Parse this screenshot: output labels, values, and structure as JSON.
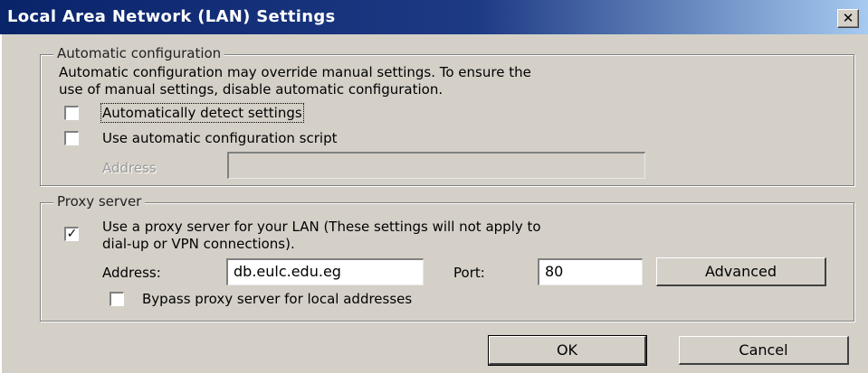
{
  "dialog": {
    "title": "Local Area Network (LAN) Settings",
    "close_glyph": "✕"
  },
  "auto_config": {
    "group_label": "Automatic configuration",
    "description_line1": "Automatic configuration may override manual settings.  To ensure the",
    "description_line2": "use of manual settings, disable automatic configuration.",
    "detect_label": "Automatically detect settings",
    "detect_checked": false,
    "script_label": "Use automatic configuration script",
    "script_checked": false,
    "address_label": "Address",
    "address_value": ""
  },
  "proxy": {
    "group_label": "Proxy server",
    "use_proxy_line1": "Use a proxy server for your LAN (These settings will not apply to",
    "use_proxy_line2": "dial-up or VPN connections).",
    "use_proxy_checked": true,
    "check_glyph": "✓",
    "address_label": "Address:",
    "address_value": "db.eulc.edu.eg",
    "port_label": "Port:",
    "port_value": "80",
    "advanced_label": "Advanced",
    "bypass_label": "Bypass proxy server for local addresses",
    "bypass_checked": false
  },
  "buttons": {
    "ok_label": "OK",
    "cancel_label": "Cancel"
  }
}
